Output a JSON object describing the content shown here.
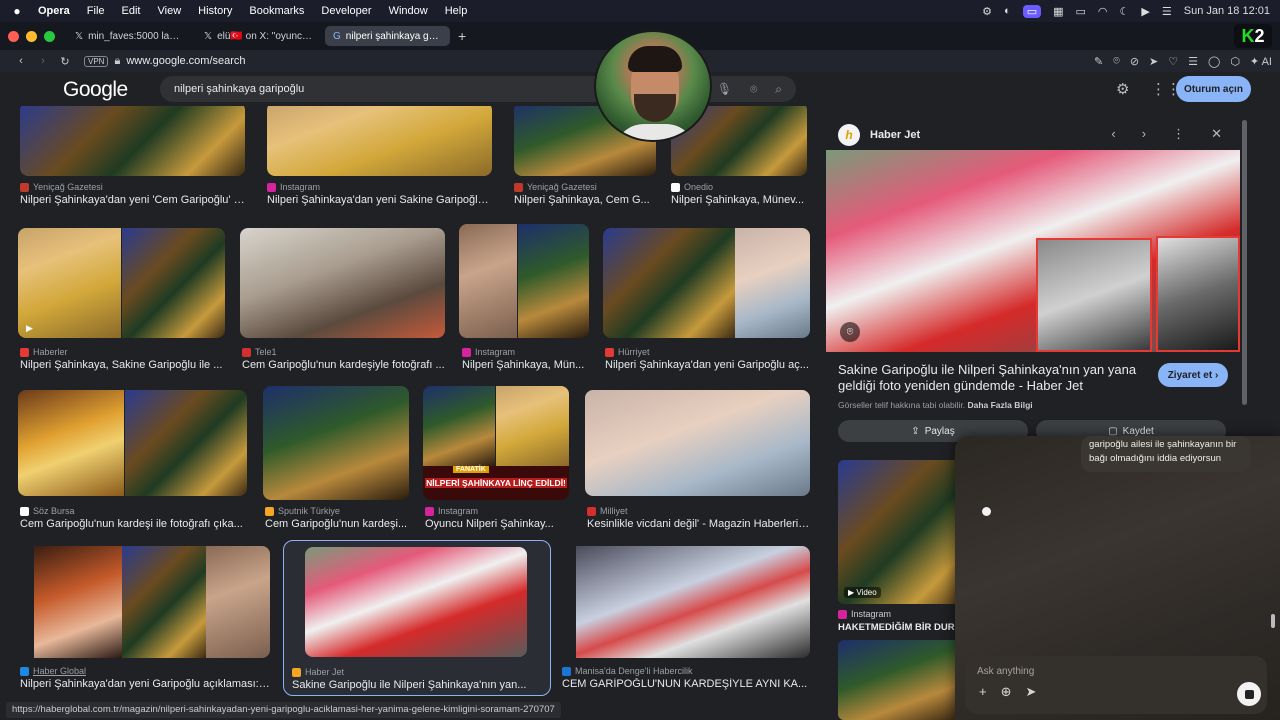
{
  "menubar": {
    "app_name": "Opera",
    "items": [
      "File",
      "Edit",
      "View",
      "History",
      "Bookmarks",
      "Developer",
      "Window",
      "Help"
    ],
    "clock": "Sun Jan 18  12:01"
  },
  "tabs": [
    {
      "label": "min_faves:5000 lang:tr",
      "icon": "x-logo-icon",
      "active": false
    },
    {
      "label": "elü🇹🇷 on X: \"oyunculuk",
      "icon": "x-logo-icon",
      "active": false
    },
    {
      "label": "nilperi şahinkaya garipoğ",
      "icon": "google-icon",
      "active": true
    }
  ],
  "k2": {
    "k": "K",
    "num": "2"
  },
  "address": {
    "vpn": "VPN",
    "url": "www.google.com/search",
    "ai_label": "AI"
  },
  "google": {
    "logo": "Google",
    "query": "nilperi şahinkaya garipoğlu",
    "signin_label": "Oturum açın"
  },
  "results": [
    {
      "source": "Yeniçağ Gazetesi",
      "title": "Nilperi Şahinkaya'dan yeni 'Cem Garipoğlu' a..."
    },
    {
      "source": "Instagram",
      "title": "Nilperi Şahinkaya'dan yeni Sakine Garipoğlu ..."
    },
    {
      "source": "Yeniçağ Gazetesi",
      "title": "Nilperi Şahinkaya, Cem G..."
    },
    {
      "source": "Onedio",
      "title": "Nilperi Şahinkaya, Münev..."
    },
    {
      "source": "Haberler",
      "title": "Nilperi Şahinkaya, Sakine Garipoğlu ile ..."
    },
    {
      "source": "Tele1",
      "title": "Cem Garipoğlu'nun kardeşiyle fotoğrafı ..."
    },
    {
      "source": "Instagram",
      "title": "Nilperi Şahinkaya, Mün..."
    },
    {
      "source": "Hürriyet",
      "title": "Nilperi Şahinkaya'dan yeni Garipoğlu aç..."
    },
    {
      "source": "Söz Bursa",
      "title": "Cem Garipoğlu'nun kardeşi ile fotoğrafı çıka..."
    },
    {
      "source": "Sputnik Türkiye",
      "title": "Cem Garipoğlu'nun kardeşi..."
    },
    {
      "source": "Instagram",
      "title": "Oyuncu Nilperi Şahinkay..."
    },
    {
      "source": "Milliyet",
      "title": "Kesinlikle vicdani değil' - Magazin Haberleri ..."
    },
    {
      "source": "Haber Global",
      "title": "Nilperi Şahinkaya'dan yeni Garipoğlu açıklaması: \"..."
    },
    {
      "source": "Haber Jet",
      "title": "Sakine Garipoğlu ile Nilperi Şahinkaya'nın yan..."
    },
    {
      "source": "Manisa'da Denge'li Habercilik",
      "title": "CEM GARİPOĞLU'NUN KARDEŞİYLE AYNI KA..."
    }
  ],
  "overlay_text": {
    "headline": "NİLPERİ ŞAHİNKAYA LİNÇ EDİLDİ!",
    "fanatik": "FANATİK"
  },
  "status_url": "https://haberglobal.com.tr/magazin/nilperi-sahinkayadan-yeni-garipoglu-aciklamasi-her-yanima-gelene-kimligini-soramam-270707",
  "panel": {
    "source": "Haber Jet",
    "title": "Sakine Garipoğlu ile Nilperi Şahinkaya'nın yan yana geldiği foto yeniden gündemde - Haber Jet",
    "visit_label": "Ziyaret et",
    "copyright_text": "Görseller telif hakkına tabi olabilir.",
    "copyright_link": "Daha Fazla Bilgi",
    "share_label": "Paylaş",
    "save_label": "Kaydet",
    "related_badge": "Video",
    "related_source": "Instagram",
    "related_title": "HAKETMEDİĞİM BİR DURU..."
  },
  "ai": {
    "message": "garipoğlu ailesi ile şahinkayanın bir bağı olmadığını iddia ediyorsun",
    "placeholder": "Ask anything"
  },
  "colors": {
    "accent": "#8ab4f8",
    "background": "#202124",
    "k2_green": "#1fe01f"
  }
}
